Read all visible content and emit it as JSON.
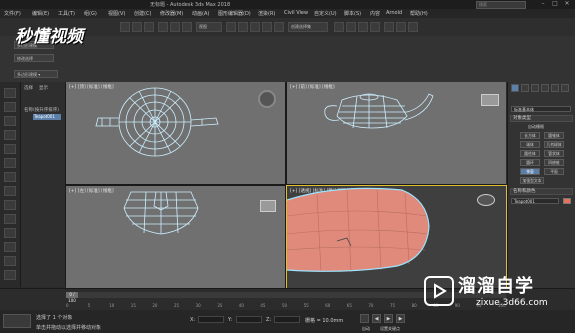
{
  "titlebar": {
    "title": "无标题 - Autodesk 3ds Max 2018",
    "search_placeholder": "搜索"
  },
  "menu": [
    "文件(F)",
    "编辑(E)",
    "工具(T)",
    "组(G)",
    "视图(V)",
    "创建(C)",
    "修改器(M)",
    "动画(A)",
    "图形编辑器(D)",
    "渲染(R)",
    "Civil View",
    "自定义(U)",
    "脚本(S)",
    "内容",
    "Arnold",
    "帮助(H)"
  ],
  "toolbar": {
    "selection_set": "创建选择集",
    "view_dropdown": "视图"
  },
  "ribbon": {
    "btn1": "多边形建模",
    "btn2": "修改选择",
    "btn3": "多边形建模 ▾"
  },
  "logo_text": "秒懂视频",
  "scene_explorer": {
    "tab1": "选择",
    "tab2": "显示",
    "root": "名称(按升序排序)",
    "item": "Teapot001"
  },
  "viewports": {
    "top": "[+] [顶] [标准] [线框]",
    "front": "[+] [前] [标准] [线框]",
    "left": "[+] [左] [标准] [线框]",
    "persp": "[+] [透视] [标准] [默认明暗处理]"
  },
  "command_panel": {
    "category": "标准基本体",
    "section1": "对象类型",
    "autogrid": "自动栅格",
    "buttons": [
      "长方体",
      "圆锥体",
      "球体",
      "几何球体",
      "圆柱体",
      "管状体",
      "圆环",
      "四棱锥",
      "茶壶",
      "平面",
      "加强型文本"
    ],
    "section2": "名称和颜色",
    "name_value": "Teapot001",
    "color": "#e4725c"
  },
  "timeline": {
    "frame": "0 / 100",
    "ticks": [
      "0",
      "5",
      "10",
      "15",
      "20",
      "25",
      "30",
      "35",
      "40",
      "45",
      "50",
      "55",
      "60",
      "65",
      "70",
      "75",
      "80",
      "85",
      "90",
      "95",
      "100"
    ]
  },
  "status": {
    "selected": "选择了 1 个对象",
    "hint": "单击并拖动以选择并移动对象",
    "x_label": "X:",
    "y_label": "Y:",
    "z_label": "Z:",
    "grid": "栅格 = 10.0mm",
    "autokey": "自动",
    "setkey": "设置关键点"
  },
  "watermark": {
    "title": "溜溜自学",
    "url": "zixue.3d66.com"
  },
  "colors": {
    "wire": "#bfe9ff",
    "viewport_bg": "#707070",
    "teapot": "#e08a7c"
  }
}
